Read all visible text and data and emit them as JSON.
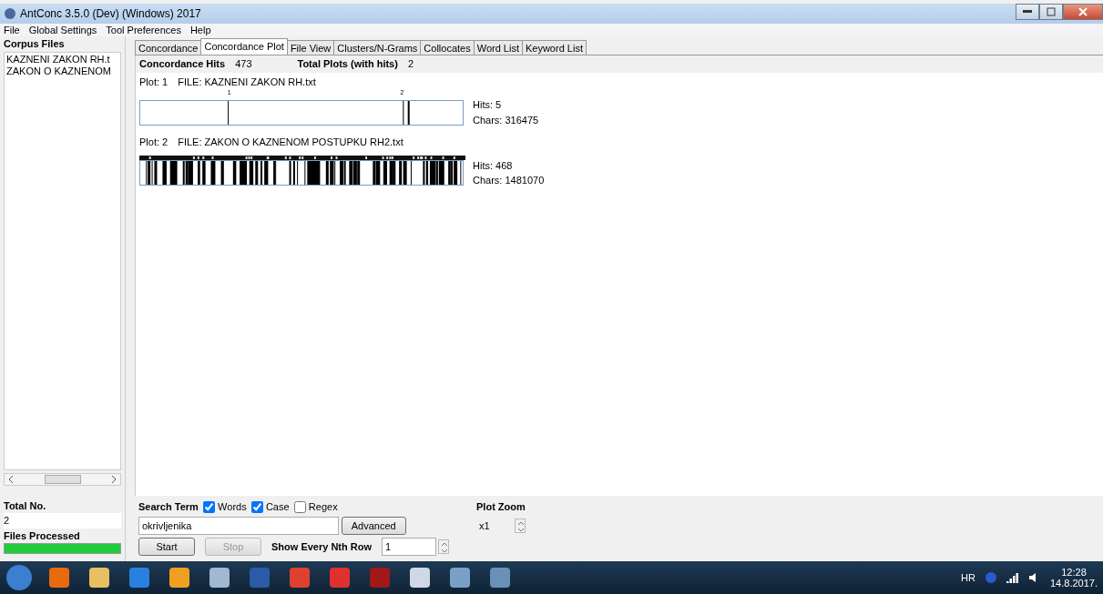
{
  "window": {
    "title": "AntConc 3.5.0 (Dev) (Windows) 2017"
  },
  "menu": [
    "File",
    "Global Settings",
    "Tool Preferences",
    "Help"
  ],
  "sidebar": {
    "heading": "Corpus Files",
    "files": [
      "KAZNENI ZAKON RH.t",
      "ZAKON O KAZNENOM"
    ],
    "total_label": "Total No.",
    "total_value": "2",
    "processed_label": "Files Processed",
    "progress": {
      "level": 1
    }
  },
  "tabs": [
    {
      "label": "Concordance",
      "selected": false
    },
    {
      "label": "Concordance Plot",
      "selected": true
    },
    {
      "label": "File View",
      "selected": false
    },
    {
      "label": "Clusters/N-Grams",
      "selected": false
    },
    {
      "label": "Collocates",
      "selected": false
    },
    {
      "label": "Word List",
      "selected": false
    },
    {
      "label": "Keyword List",
      "selected": false
    }
  ],
  "summary": {
    "hits_label": "Concordance Hits",
    "hits_value": "473",
    "plots_label": "Total Plots (with hits)",
    "plots_value": "2"
  },
  "plots": [
    {
      "plot_label": "Plot: 1",
      "file": "FILE: KAZNENI ZAKON RH.txt",
      "markers": [
        "1",
        "2"
      ],
      "dense": false,
      "hits": "Hits: 5",
      "chars": "Chars: 316475"
    },
    {
      "plot_label": "Plot: 2",
      "file": "FILE: ZAKON O KAZNENOM POSTUPKU RH2.txt",
      "dense": true,
      "hits": "Hits: 468",
      "chars": "Chars: 1481070"
    }
  ],
  "search": {
    "label": "Search Term",
    "options": [
      {
        "label": "Words",
        "checked": true
      },
      {
        "label": "Case",
        "checked": true
      },
      {
        "label": "Regex",
        "checked": false
      }
    ],
    "value": "okrivljenika",
    "advanced": "Advanced",
    "start": "Start",
    "stop": {
      "label": "Stop",
      "disabled": true
    },
    "nth_label": "Show Every Nth Row",
    "nth_value": "1"
  },
  "zoom": {
    "label": "Plot Zoom",
    "value": "x1"
  },
  "taskbar": {
    "language": "HR",
    "time": "12:28",
    "date": "14.8.2017."
  }
}
